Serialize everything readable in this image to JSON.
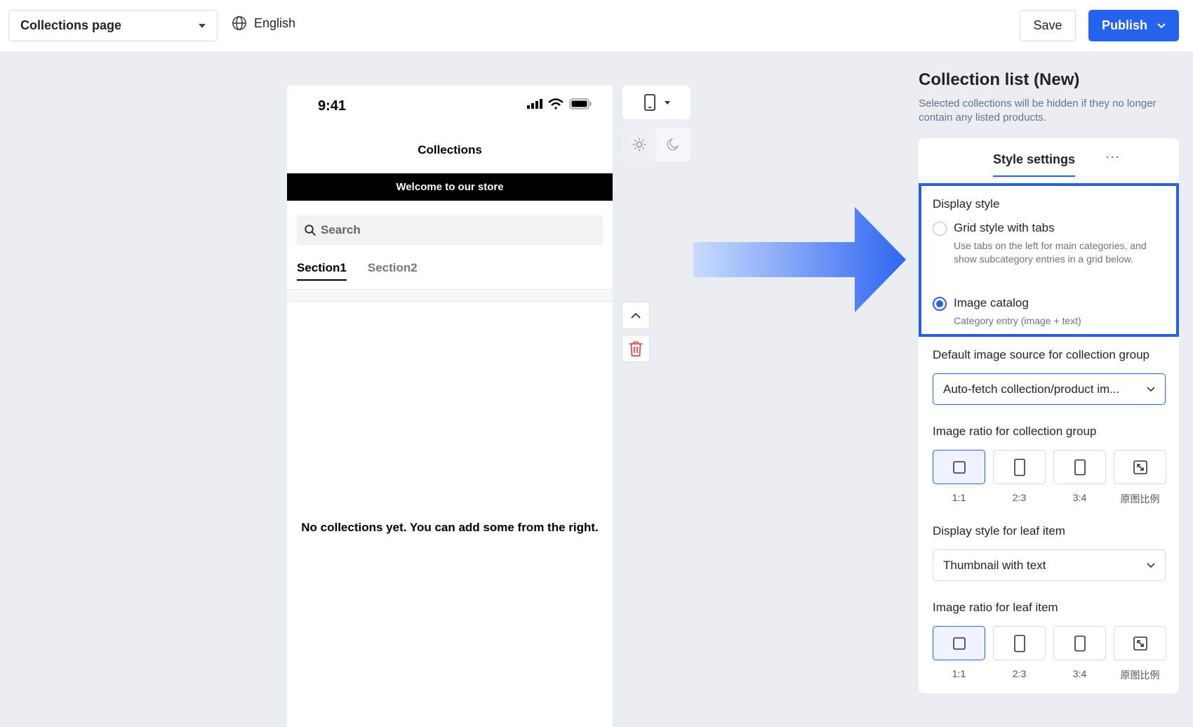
{
  "topbar": {
    "page_select": "Collections page",
    "language": "English",
    "save_label": "Save",
    "publish_label": "Publish"
  },
  "phone": {
    "time": "9:41",
    "title": "Collections",
    "banner": "Welcome to our store",
    "search_placeholder": "Search",
    "tabs": [
      "Section1",
      "Section2"
    ],
    "empty_message": "No collections yet. You can add some from the right."
  },
  "panel": {
    "title": "Collection list (New)",
    "description": "Selected collections will be hidden if they no longer contain any listed products.",
    "tab": "Style settings",
    "more": "···",
    "display_style": {
      "label": "Display style",
      "options": [
        {
          "title": "Grid style with tabs",
          "subtitle": "Use tabs on the left for main categories, and show subcategory entries in a grid below.",
          "selected": false
        },
        {
          "title": "Image catalog",
          "subtitle": "Category entry (image + text)",
          "selected": true
        }
      ]
    },
    "image_source": {
      "label": "Default image source for collection group",
      "value": "Auto-fetch collection/product im..."
    },
    "group_ratio": {
      "label": "Image ratio for collection group",
      "options": [
        "1:1",
        "2:3",
        "3:4",
        "原图比例"
      ],
      "selected": "1:1"
    },
    "leaf_style": {
      "label": "Display style for leaf item",
      "value": "Thumbnail with text"
    },
    "leaf_ratio": {
      "label": "Image ratio for leaf item",
      "options": [
        "1:1",
        "2:3",
        "3:4",
        "原图比例"
      ],
      "selected": "1:1"
    }
  },
  "colors": {
    "accent": "#2463eb",
    "highlight_border": "#2a5fe0",
    "delete": "#e5484d"
  }
}
